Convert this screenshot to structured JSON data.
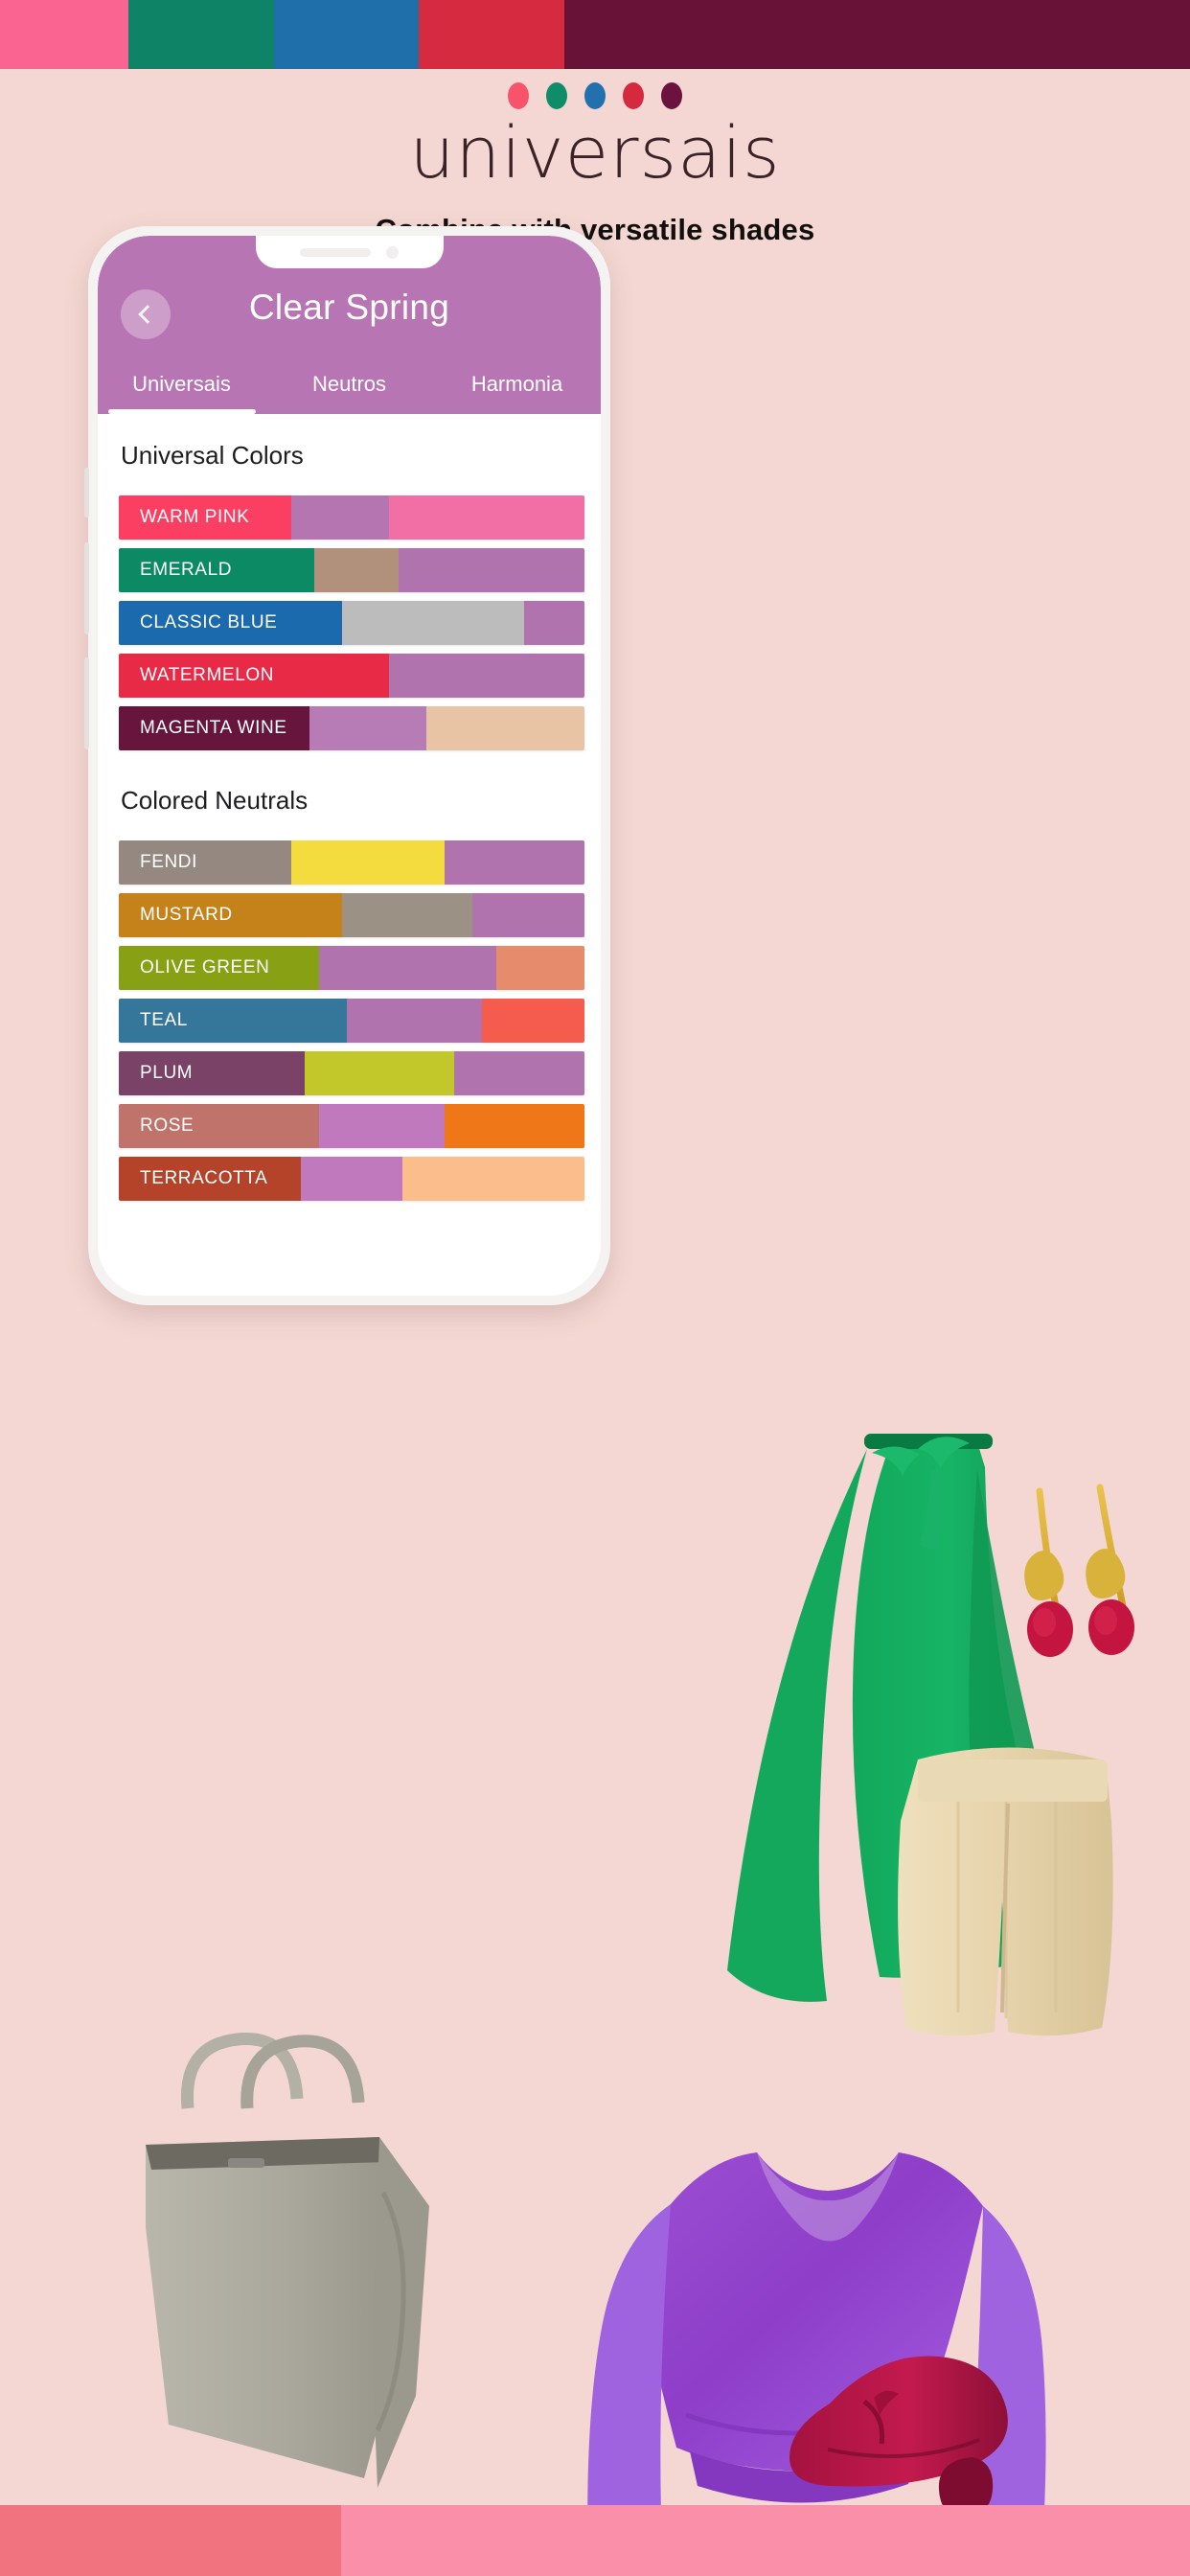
{
  "brand": {
    "title": "universais",
    "subtitle": "Combine with versatile shades",
    "dot_colors": [
      "#f9536b",
      "#0e8d68",
      "#2270ae",
      "#d5293f",
      "#6b123f"
    ]
  },
  "top_strip": [
    {
      "name": "warm-pink",
      "color": "#f96490",
      "width_pct": 10.8
    },
    {
      "name": "emerald",
      "color": "#0e8365",
      "width_pct": 12.2
    },
    {
      "name": "classic-blue",
      "color": "#1f6fab",
      "width_pct": 12.2
    },
    {
      "name": "watermelon",
      "color": "#d62a40",
      "width_pct": 12.2
    },
    {
      "name": "magenta-wine",
      "color": "#681238",
      "width_pct": 52.6
    }
  ],
  "bottom_strip": [
    {
      "name": "warm-coral",
      "color": "#f27380",
      "width_pct": 28.7
    },
    {
      "name": "soft-pink",
      "color": "#f98fa8",
      "width_pct": 71.3
    }
  ],
  "phone": {
    "header": {
      "back_icon": "chevron-left-icon",
      "title": "Clear Spring",
      "accent": "#b875b4",
      "tabs": [
        {
          "label": "Universais",
          "active": true
        },
        {
          "label": "Neutros",
          "active": false
        },
        {
          "label": "Harmonia",
          "active": false
        }
      ]
    },
    "sections": [
      {
        "heading": "Universal Colors",
        "rows": [
          {
            "label": "WARM PINK",
            "segments": [
              {
                "color": "#fa3f62",
                "width_pct": 37,
                "labelled": true
              },
              {
                "color": "#b575b0",
                "width_pct": 21
              },
              {
                "color": "#f16fa5",
                "width_pct": 42
              }
            ]
          },
          {
            "label": "EMERALD",
            "segments": [
              {
                "color": "#0c8a63",
                "width_pct": 42,
                "labelled": true
              },
              {
                "color": "#b2917c",
                "width_pct": 18
              },
              {
                "color": "#b073ae",
                "width_pct": 40
              }
            ]
          },
          {
            "label": "CLASSIC BLUE",
            "segments": [
              {
                "color": "#1b6aad",
                "width_pct": 48,
                "labelled": true
              },
              {
                "color": "#bcbcbc",
                "width_pct": 39
              },
              {
                "color": "#b073ae",
                "width_pct": 13
              }
            ]
          },
          {
            "label": "WATERMELON",
            "segments": [
              {
                "color": "#e82a47",
                "width_pct": 58,
                "labelled": true
              },
              {
                "color": "#b073ae",
                "width_pct": 42
              }
            ]
          },
          {
            "label": "MAGENTA WINE",
            "segments": [
              {
                "color": "#68153e",
                "width_pct": 41,
                "labelled": true
              },
              {
                "color": "#b77cb6",
                "width_pct": 25
              },
              {
                "color": "#e8c4a5",
                "width_pct": 34
              }
            ]
          }
        ]
      },
      {
        "heading": "Colored Neutrals",
        "rows": [
          {
            "label": "FENDI",
            "segments": [
              {
                "color": "#958880",
                "width_pct": 37,
                "labelled": true
              },
              {
                "color": "#f4dc3f",
                "width_pct": 33
              },
              {
                "color": "#b073ae",
                "width_pct": 30
              }
            ]
          },
          {
            "label": "MUSTARD",
            "segments": [
              {
                "color": "#c5821a",
                "width_pct": 48,
                "labelled": true
              },
              {
                "color": "#9b9185",
                "width_pct": 28
              },
              {
                "color": "#b073ae",
                "width_pct": 24
              }
            ]
          },
          {
            "label": "OLIVE GREEN",
            "segments": [
              {
                "color": "#87a014",
                "width_pct": 43,
                "labelled": true
              },
              {
                "color": "#b073ae",
                "width_pct": 38
              },
              {
                "color": "#e68b6b",
                "width_pct": 19
              }
            ]
          },
          {
            "label": "TEAL",
            "segments": [
              {
                "color": "#35779a",
                "width_pct": 49,
                "labelled": true
              },
              {
                "color": "#b073ae",
                "width_pct": 29
              },
              {
                "color": "#f65c4e",
                "width_pct": 22
              }
            ]
          },
          {
            "label": "PLUM",
            "segments": [
              {
                "color": "#7a4266",
                "width_pct": 40,
                "labelled": true
              },
              {
                "color": "#c2c829",
                "width_pct": 32
              },
              {
                "color": "#b073ae",
                "width_pct": 28
              }
            ]
          },
          {
            "label": "ROSE",
            "segments": [
              {
                "color": "#bf736b",
                "width_pct": 43,
                "labelled": true
              },
              {
                "color": "#bf79bc",
                "width_pct": 27
              },
              {
                "color": "#ef7718",
                "width_pct": 30
              }
            ]
          },
          {
            "label": "TERRACOTTA",
            "segments": [
              {
                "color": "#b4432a",
                "width_pct": 39,
                "labelled": true
              },
              {
                "color": "#bf79bc",
                "width_pct": 22
              },
              {
                "color": "#fbbd8c",
                "width_pct": 39
              }
            ]
          }
        ]
      }
    ]
  },
  "products": [
    {
      "name": "handbag",
      "label": "Grey leather tote bag"
    },
    {
      "name": "green-skirt",
      "label": "Emerald green ruffled wrap skirt"
    },
    {
      "name": "earrings",
      "label": "Gold and red teardrop earrings"
    },
    {
      "name": "beige-shorts",
      "label": "Beige pleated shorts"
    },
    {
      "name": "purple-blouse",
      "label": "Purple satin v-neck blouse"
    },
    {
      "name": "burgundy-shoe",
      "label": "Burgundy block heel pump"
    }
  ]
}
